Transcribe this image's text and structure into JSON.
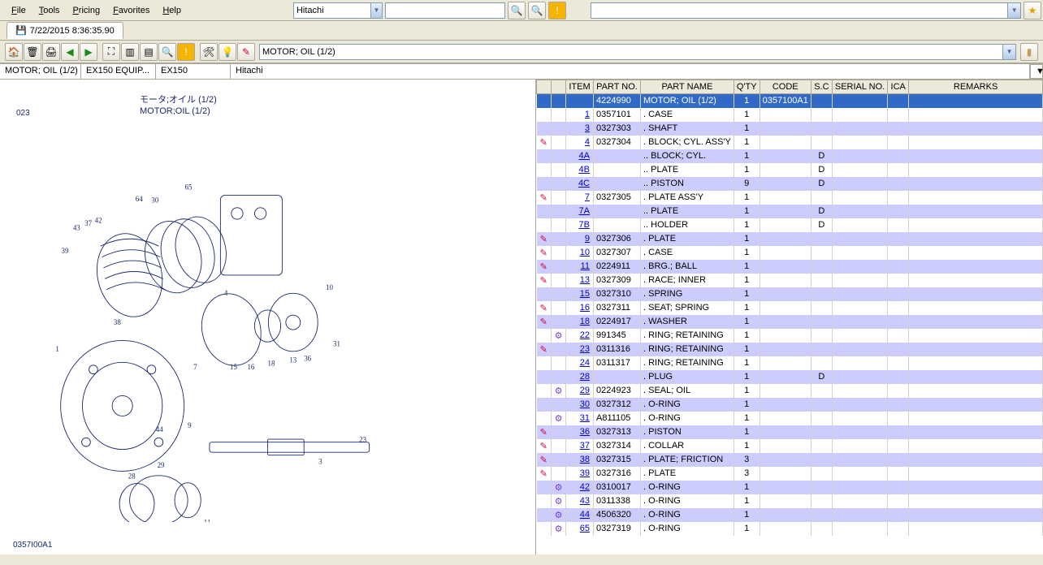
{
  "menu": {
    "file": "File",
    "tools": "Tools",
    "pricing": "Pricing",
    "favorites": "Favorites",
    "help": "Help"
  },
  "top": {
    "brand_select": "Hitachi",
    "search_value": "",
    "search2_value": ""
  },
  "tab": {
    "timestamp": "7/22/2015 8:36:35.90"
  },
  "toolbar2": {
    "title_field": "MOTOR; OIL (1/2)"
  },
  "breadcrumb": {
    "c1": "MOTOR; OIL (1/2)",
    "c2": "EX150 EQUIP...",
    "c3": "EX150",
    "c4": "Hitachi"
  },
  "diagram": {
    "title_jp": "モータ;オイル (1/2)",
    "title_en": "MOTOR;OIL (1/2)",
    "code_top": "023",
    "code_bot": "0357I00A1"
  },
  "headers": {
    "flag": "",
    "icon": "",
    "item": "ITEM",
    "partno": "PART NO.",
    "name": "PART NAME",
    "qty": "Q'TY",
    "code": "CODE",
    "sc": "S.C",
    "serial": "SERIAL NO.",
    "ica": "ICA",
    "remarks": "REMARKS"
  },
  "rows": [
    {
      "sel": true,
      "flag": "",
      "icon": "",
      "item": "",
      "partno": "4224990",
      "name": "MOTOR; OIL (1/2)",
      "qty": "1",
      "code": "0357100A1",
      "sc": "",
      "serial": "",
      "ica": "",
      "remarks": ""
    },
    {
      "flag": "",
      "icon": "",
      "item": "1",
      "partno": "0357101",
      "name": ". CASE",
      "qty": "1",
      "code": "",
      "sc": "",
      "serial": "",
      "ica": "",
      "remarks": ""
    },
    {
      "alt": true,
      "flag": "",
      "icon": "",
      "item": "3",
      "partno": "0327303",
      "name": ". SHAFT",
      "qty": "1",
      "code": "",
      "sc": "",
      "serial": "",
      "ica": "",
      "remarks": ""
    },
    {
      "flag": "✎",
      "icon": "",
      "item": "4",
      "partno": "0327304",
      "name": ". BLOCK; CYL. ASS'Y",
      "qty": "1",
      "code": "",
      "sc": "",
      "serial": "",
      "ica": "",
      "remarks": ""
    },
    {
      "alt": true,
      "flag": "",
      "icon": "",
      "item": "4A",
      "partno": "",
      "name": ".. BLOCK; CYL.",
      "qty": "1",
      "code": "",
      "sc": "D",
      "serial": "",
      "ica": "",
      "remarks": ""
    },
    {
      "flag": "",
      "icon": "",
      "item": "4B",
      "partno": "",
      "name": ".. PLATE",
      "qty": "1",
      "code": "",
      "sc": "D",
      "serial": "",
      "ica": "",
      "remarks": ""
    },
    {
      "alt": true,
      "flag": "",
      "icon": "",
      "item": "4C",
      "partno": "",
      "name": ".. PISTON",
      "qty": "9",
      "code": "",
      "sc": "D",
      "serial": "",
      "ica": "",
      "remarks": ""
    },
    {
      "flag": "✎",
      "icon": "",
      "item": "7",
      "partno": "0327305",
      "name": ". PLATE ASS'Y",
      "qty": "1",
      "code": "",
      "sc": "",
      "serial": "",
      "ica": "",
      "remarks": ""
    },
    {
      "alt": true,
      "flag": "",
      "icon": "",
      "item": "7A",
      "partno": "",
      "name": ".. PLATE",
      "qty": "1",
      "code": "",
      "sc": "D",
      "serial": "",
      "ica": "",
      "remarks": ""
    },
    {
      "flag": "",
      "icon": "",
      "item": "7B",
      "partno": "",
      "name": ".. HOLDER",
      "qty": "1",
      "code": "",
      "sc": "D",
      "serial": "",
      "ica": "",
      "remarks": ""
    },
    {
      "alt": true,
      "flag": "✎",
      "icon": "",
      "item": "9",
      "partno": "0327306",
      "name": ". PLATE",
      "qty": "1",
      "code": "",
      "sc": "",
      "serial": "",
      "ica": "",
      "remarks": ""
    },
    {
      "flag": "✎",
      "icon": "",
      "item": "10",
      "partno": "0327307",
      "name": ". CASE",
      "qty": "1",
      "code": "",
      "sc": "",
      "serial": "",
      "ica": "",
      "remarks": ""
    },
    {
      "alt": true,
      "flag": "✎",
      "icon": "",
      "item": "11",
      "partno": "0224911",
      "name": ". BRG.; BALL",
      "qty": "1",
      "code": "",
      "sc": "",
      "serial": "",
      "ica": "",
      "remarks": ""
    },
    {
      "flag": "✎",
      "icon": "",
      "item": "13",
      "partno": "0327309",
      "name": ". RACE; INNER",
      "qty": "1",
      "code": "",
      "sc": "",
      "serial": "",
      "ica": "",
      "remarks": ""
    },
    {
      "alt": true,
      "flag": "",
      "icon": "",
      "item": "15",
      "partno": "0327310",
      "name": ". SPRING",
      "qty": "1",
      "code": "",
      "sc": "",
      "serial": "",
      "ica": "",
      "remarks": ""
    },
    {
      "flag": "✎",
      "icon": "",
      "item": "16",
      "partno": "0327311",
      "name": ". SEAT; SPRING",
      "qty": "1",
      "code": "",
      "sc": "",
      "serial": "",
      "ica": "",
      "remarks": ""
    },
    {
      "alt": true,
      "flag": "✎",
      "icon": "",
      "item": "18",
      "partno": "0224917",
      "name": ". WASHER",
      "qty": "1",
      "code": "",
      "sc": "",
      "serial": "",
      "ica": "",
      "remarks": ""
    },
    {
      "flag": "",
      "icon": "⚙",
      "item": "22",
      "partno": "991345",
      "name": ". RING; RETAINING",
      "qty": "1",
      "code": "",
      "sc": "",
      "serial": "",
      "ica": "",
      "remarks": ""
    },
    {
      "alt": true,
      "flag": "✎",
      "icon": "",
      "item": "23",
      "partno": "0311316",
      "name": ". RING; RETAINING",
      "qty": "1",
      "code": "",
      "sc": "",
      "serial": "",
      "ica": "",
      "remarks": ""
    },
    {
      "flag": "",
      "icon": "",
      "item": "24",
      "partno": "0311317",
      "name": ". RING; RETAINING",
      "qty": "1",
      "code": "",
      "sc": "",
      "serial": "",
      "ica": "",
      "remarks": ""
    },
    {
      "alt": true,
      "flag": "",
      "icon": "",
      "item": "28",
      "partno": "",
      "name": ". PLUG",
      "qty": "1",
      "code": "",
      "sc": "D",
      "serial": "",
      "ica": "",
      "remarks": ""
    },
    {
      "flag": "",
      "icon": "⚙",
      "item": "29",
      "partno": "0224923",
      "name": ". SEAL; OIL",
      "qty": "1",
      "code": "",
      "sc": "",
      "serial": "",
      "ica": "",
      "remarks": ""
    },
    {
      "alt": true,
      "flag": "",
      "icon": "",
      "item": "30",
      "partno": "0327312",
      "name": ". O-RING",
      "qty": "1",
      "code": "",
      "sc": "",
      "serial": "",
      "ica": "",
      "remarks": ""
    },
    {
      "flag": "",
      "icon": "⚙",
      "item": "31",
      "partno": "A811105",
      "name": ". O-RING",
      "qty": "1",
      "code": "",
      "sc": "",
      "serial": "",
      "ica": "",
      "remarks": ""
    },
    {
      "alt": true,
      "flag": "✎",
      "icon": "",
      "item": "36",
      "partno": "0327313",
      "name": ". PISTON",
      "qty": "1",
      "code": "",
      "sc": "",
      "serial": "",
      "ica": "",
      "remarks": ""
    },
    {
      "flag": "✎",
      "icon": "",
      "item": "37",
      "partno": "0327314",
      "name": ". COLLAR",
      "qty": "1",
      "code": "",
      "sc": "",
      "serial": "",
      "ica": "",
      "remarks": ""
    },
    {
      "alt": true,
      "flag": "✎",
      "icon": "",
      "item": "38",
      "partno": "0327315",
      "name": ". PLATE; FRICTION",
      "qty": "3",
      "code": "",
      "sc": "",
      "serial": "",
      "ica": "",
      "remarks": ""
    },
    {
      "flag": "✎",
      "icon": "",
      "item": "39",
      "partno": "0327316",
      "name": ". PLATE",
      "qty": "3",
      "code": "",
      "sc": "",
      "serial": "",
      "ica": "",
      "remarks": ""
    },
    {
      "alt": true,
      "flag": "",
      "icon": "⚙",
      "item": "42",
      "partno": "0310017",
      "name": ". O-RING",
      "qty": "1",
      "code": "",
      "sc": "",
      "serial": "",
      "ica": "",
      "remarks": ""
    },
    {
      "flag": "",
      "icon": "⚙",
      "item": "43",
      "partno": "0311338",
      "name": ". O-RING",
      "qty": "1",
      "code": "",
      "sc": "",
      "serial": "",
      "ica": "",
      "remarks": ""
    },
    {
      "alt": true,
      "flag": "",
      "icon": "⚙",
      "item": "44",
      "partno": "4506320",
      "name": ". O-RING",
      "qty": "1",
      "code": "",
      "sc": "",
      "serial": "",
      "ica": "",
      "remarks": ""
    },
    {
      "flag": "",
      "icon": "⚙",
      "item": "65",
      "partno": "0327319",
      "name": ". O-RING",
      "qty": "1",
      "code": "",
      "sc": "",
      "serial": "",
      "ica": "",
      "remarks": ""
    }
  ]
}
